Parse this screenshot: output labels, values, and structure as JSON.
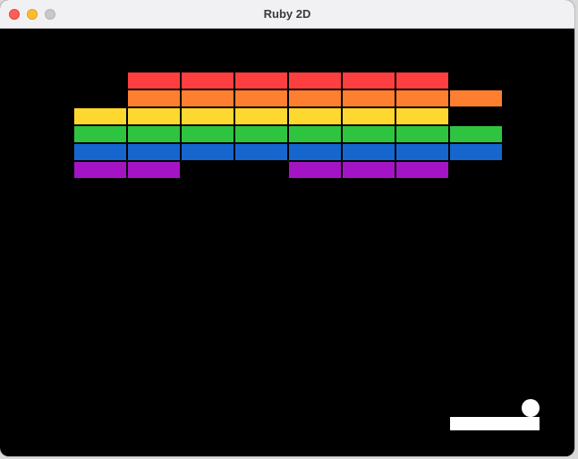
{
  "window": {
    "title": "Ruby 2D"
  },
  "colors": {
    "red": "#fe3f3f",
    "orange": "#fe7f2f",
    "yellow": "#ffd82f",
    "green": "#2fc440",
    "blue": "#1666cf",
    "purple": "#a514c4",
    "paddle": "#ffffff",
    "ball": "#ffffff",
    "background": "#000000"
  },
  "bricks": {
    "columns": 8,
    "rows": [
      {
        "color": "red",
        "present": [
          false,
          true,
          true,
          true,
          true,
          true,
          true,
          false
        ]
      },
      {
        "color": "orange",
        "present": [
          false,
          true,
          true,
          true,
          true,
          true,
          true,
          true
        ]
      },
      {
        "color": "yellow",
        "present": [
          true,
          true,
          true,
          true,
          true,
          true,
          true,
          false
        ]
      },
      {
        "color": "green",
        "present": [
          true,
          true,
          true,
          true,
          true,
          true,
          true,
          true
        ]
      },
      {
        "color": "blue",
        "present": [
          true,
          true,
          true,
          true,
          true,
          true,
          true,
          true
        ]
      },
      {
        "color": "purple",
        "present": [
          true,
          true,
          false,
          false,
          true,
          true,
          true,
          false
        ]
      }
    ]
  }
}
